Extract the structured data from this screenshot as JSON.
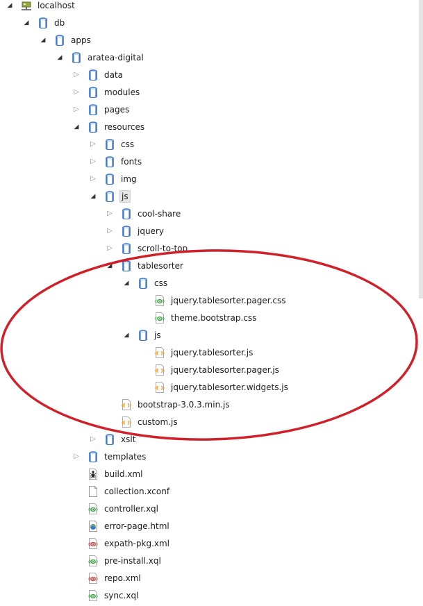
{
  "tree": {
    "nodes": [
      {
        "label": "localhost",
        "icon": "server-icon",
        "depth": 0,
        "toggle": "expanded",
        "selected": false
      },
      {
        "label": "db",
        "icon": "database-icon",
        "depth": 1,
        "toggle": "expanded",
        "selected": false
      },
      {
        "label": "apps",
        "icon": "database-icon",
        "depth": 2,
        "toggle": "expanded",
        "selected": false
      },
      {
        "label": "aratea-digital",
        "icon": "database-icon",
        "depth": 3,
        "toggle": "expanded",
        "selected": false
      },
      {
        "label": "data",
        "icon": "database-icon",
        "depth": 4,
        "toggle": "collapsed",
        "selected": false
      },
      {
        "label": "modules",
        "icon": "database-icon",
        "depth": 4,
        "toggle": "collapsed",
        "selected": false
      },
      {
        "label": "pages",
        "icon": "database-icon",
        "depth": 4,
        "toggle": "collapsed",
        "selected": false
      },
      {
        "label": "resources",
        "icon": "database-icon",
        "depth": 4,
        "toggle": "expanded",
        "selected": false
      },
      {
        "label": "css",
        "icon": "database-icon",
        "depth": 5,
        "toggle": "collapsed",
        "selected": false
      },
      {
        "label": "fonts",
        "icon": "database-icon",
        "depth": 5,
        "toggle": "collapsed",
        "selected": false
      },
      {
        "label": "img",
        "icon": "database-icon",
        "depth": 5,
        "toggle": "collapsed",
        "selected": false
      },
      {
        "label": "js",
        "icon": "database-icon",
        "depth": 5,
        "toggle": "expanded",
        "selected": true
      },
      {
        "label": "cool-share",
        "icon": "database-icon",
        "depth": 6,
        "toggle": "collapsed",
        "selected": false
      },
      {
        "label": "jquery",
        "icon": "database-icon",
        "depth": 6,
        "toggle": "collapsed",
        "selected": false
      },
      {
        "label": "scroll-to-top",
        "icon": "database-icon",
        "depth": 6,
        "toggle": "collapsed",
        "selected": false
      },
      {
        "label": "tablesorter",
        "icon": "database-icon",
        "depth": 6,
        "toggle": "expanded",
        "selected": false
      },
      {
        "label": "css",
        "icon": "database-icon",
        "depth": 7,
        "toggle": "expanded",
        "selected": false
      },
      {
        "label": "jquery.tablesorter.pager.css",
        "icon": "css-file-icon",
        "depth": 8,
        "toggle": "none",
        "selected": false
      },
      {
        "label": "theme.bootstrap.css",
        "icon": "css-file-icon",
        "depth": 8,
        "toggle": "none",
        "selected": false
      },
      {
        "label": "js",
        "icon": "database-icon",
        "depth": 7,
        "toggle": "expanded",
        "selected": false
      },
      {
        "label": "jquery.tablesorter.js",
        "icon": "js-file-icon",
        "depth": 8,
        "toggle": "none",
        "selected": false
      },
      {
        "label": "jquery.tablesorter.pager.js",
        "icon": "js-file-icon",
        "depth": 8,
        "toggle": "none",
        "selected": false
      },
      {
        "label": "jquery.tablesorter.widgets.js",
        "icon": "js-file-icon",
        "depth": 8,
        "toggle": "none",
        "selected": false
      },
      {
        "label": "bootstrap-3.0.3.min.js",
        "icon": "js-file-icon",
        "depth": 6,
        "toggle": "none",
        "selected": false
      },
      {
        "label": "custom.js",
        "icon": "js-file-icon",
        "depth": 6,
        "toggle": "none",
        "selected": false
      },
      {
        "label": "xslt",
        "icon": "database-icon",
        "depth": 5,
        "toggle": "collapsed",
        "selected": false
      },
      {
        "label": "templates",
        "icon": "database-icon",
        "depth": 4,
        "toggle": "collapsed",
        "selected": false
      },
      {
        "label": "build.xml",
        "icon": "ant-file-icon",
        "depth": 4,
        "toggle": "none",
        "selected": false
      },
      {
        "label": "collection.xconf",
        "icon": "blank-file-icon",
        "depth": 4,
        "toggle": "none",
        "selected": false
      },
      {
        "label": "controller.xql",
        "icon": "xquery-file-icon",
        "depth": 4,
        "toggle": "none",
        "selected": false
      },
      {
        "label": "error-page.html",
        "icon": "html-file-icon",
        "depth": 4,
        "toggle": "none",
        "selected": false
      },
      {
        "label": "expath-pkg.xml",
        "icon": "xml-file-icon",
        "depth": 4,
        "toggle": "none",
        "selected": false
      },
      {
        "label": "pre-install.xql",
        "icon": "xquery-file-icon",
        "depth": 4,
        "toggle": "none",
        "selected": false
      },
      {
        "label": "repo.xml",
        "icon": "xml-file-icon",
        "depth": 4,
        "toggle": "none",
        "selected": false
      },
      {
        "label": "sync.xql",
        "icon": "xquery-file-icon",
        "depth": 4,
        "toggle": "none",
        "selected": false
      }
    ]
  },
  "colors": {
    "annotation_ellipse": "#d0202a",
    "collection_blue": "#3a78c8",
    "xquery_green": "#2e9e3a",
    "xml_red": "#d03030",
    "js_orange": "#e08a1e"
  },
  "annotation": {
    "shape": "ellipse",
    "highlights": "tablesorter"
  }
}
